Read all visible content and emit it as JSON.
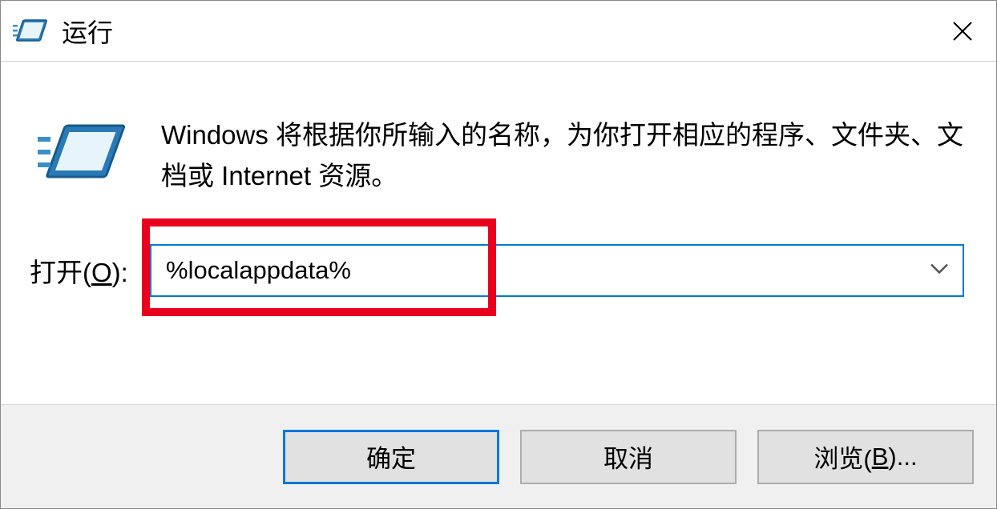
{
  "titlebar": {
    "title": "运行"
  },
  "description": "Windows 将根据你所输入的名称，为你打开相应的程序、文件夹、文档或 Internet 资源。",
  "open_label_prefix": "打开(",
  "open_label_key": "O",
  "open_label_suffix": "):",
  "input": {
    "value": "%localappdata%"
  },
  "buttons": {
    "ok": "确定",
    "cancel": "取消",
    "browse_prefix": "浏览(",
    "browse_key": "B",
    "browse_suffix": ")..."
  }
}
